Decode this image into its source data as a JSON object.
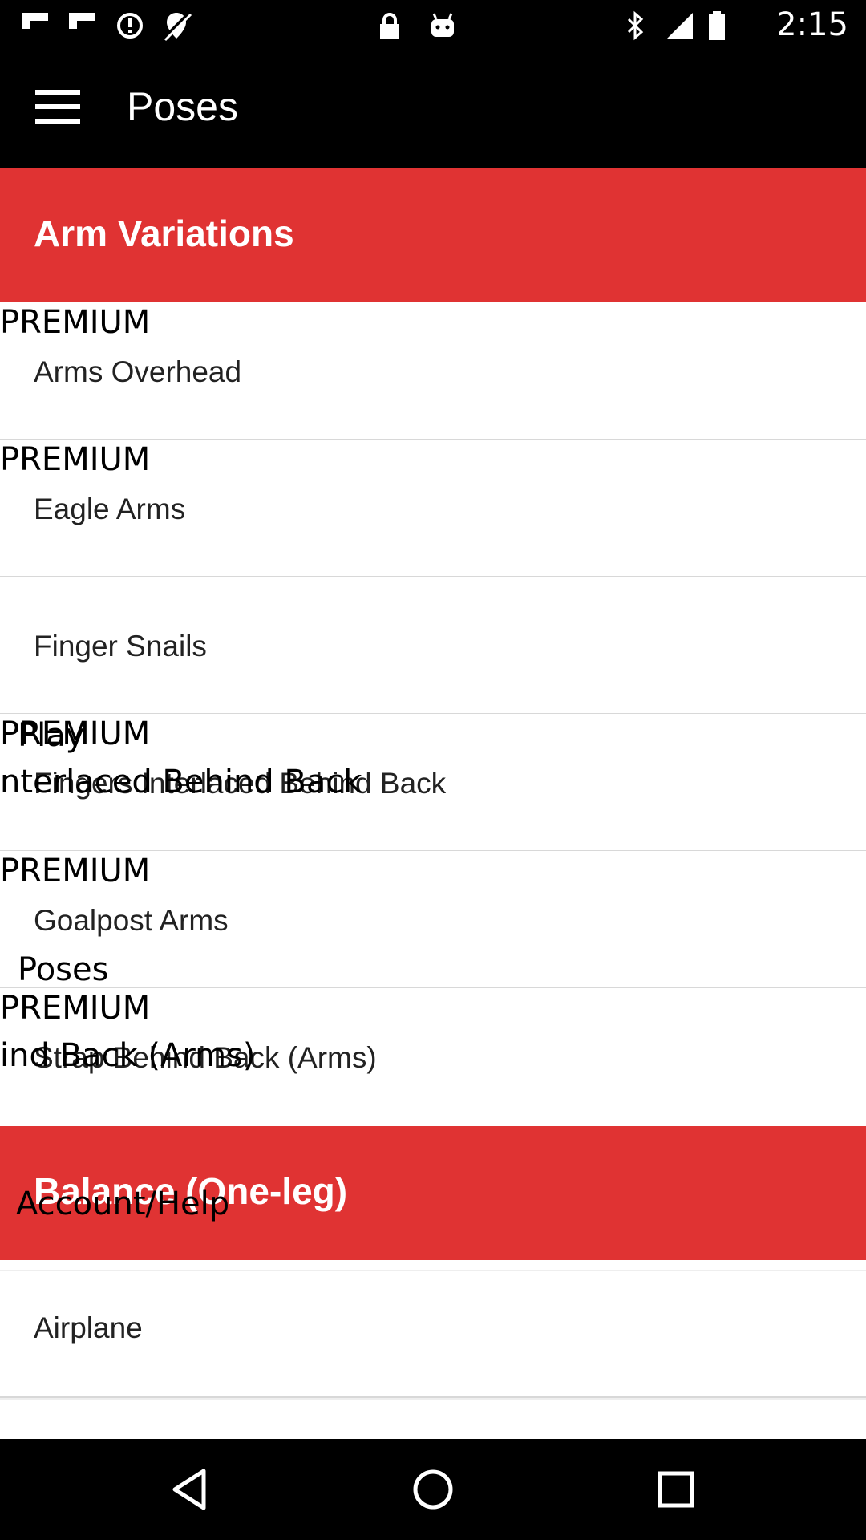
{
  "status_bar": {
    "time": "2:15",
    "icons": [
      "flipboard-icon",
      "flipboard-icon",
      "sync-problem-icon",
      "location-off-icon",
      "lock-icon",
      "android-icon",
      "bluetooth-icon",
      "signal-icon",
      "battery-icon"
    ]
  },
  "app_bar": {
    "title": "Poses",
    "menu_icon": "hamburger-menu-icon"
  },
  "list": {
    "sections": [
      {
        "label": "Arm Variations"
      },
      {
        "label": "Balance (One-leg)"
      }
    ],
    "items": [
      {
        "badge": "PREMIUM",
        "name": "Arms Overhead"
      },
      {
        "badge": "PREMIUM",
        "name": "Eagle Arms"
      },
      {
        "badge": "",
        "name": "Finger Snails"
      },
      {
        "badge": "PREMIUM",
        "name": "Fingers Interlaced Behind Back"
      },
      {
        "badge": "PREMIUM",
        "name": "Goalpost Arms"
      },
      {
        "badge": "PREMIUM",
        "name": "Strap Behind Back (Arms)"
      },
      {
        "badge": "",
        "name": "Airplane"
      }
    ]
  },
  "drawer_ghost": {
    "item1": "Play",
    "item1_sub": "nterlaced Behind Back",
    "item2": "Poses",
    "item2_sub": "ind Back (Arms)",
    "item3": "Account/Help"
  },
  "nav_bar": {
    "back_icon": "back-triangle-icon",
    "home_icon": "home-circle-icon",
    "recents_icon": "recents-square-icon"
  }
}
